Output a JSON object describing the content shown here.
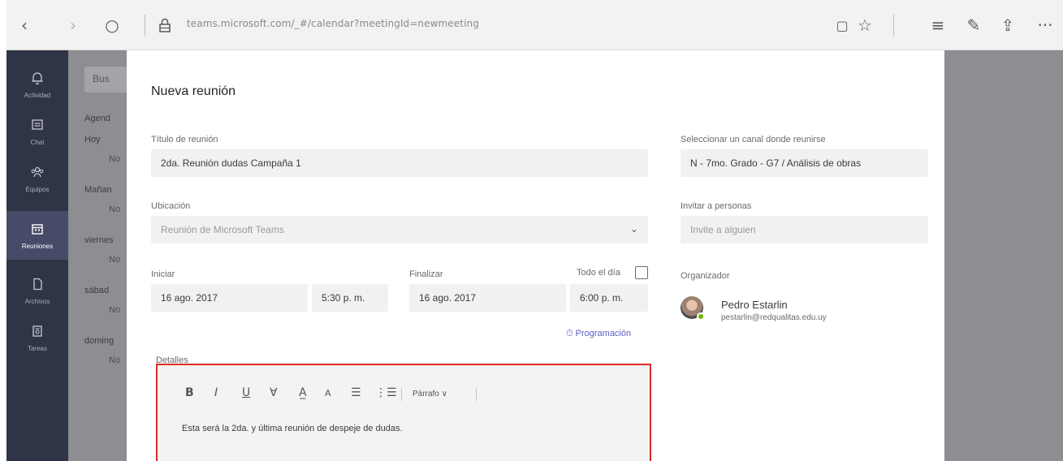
{
  "browser": {
    "url": "teams.microsoft.com/_#/calendar?meetingId=newmeeting",
    "back_icon": "‹",
    "forward_icon": "›",
    "refresh_icon": "○",
    "lock_icon": "🔒",
    "reading_icon": "▢",
    "favorite_icon": "☆",
    "hub_icon": "≡",
    "notes_icon": "✎",
    "share_icon": "⇪",
    "more_icon": "···"
  },
  "rail": {
    "items": [
      {
        "label": "Actividad",
        "icon": "bell-icon",
        "glyph": "🔔"
      },
      {
        "label": "Chat",
        "icon": "chat-icon",
        "glyph": "▤"
      },
      {
        "label": "Equipos",
        "icon": "teams-icon",
        "glyph": "⁂"
      },
      {
        "label": "Reuniones",
        "icon": "calendar-icon",
        "glyph": "▦"
      },
      {
        "label": "Archivos",
        "icon": "files-icon",
        "glyph": "▯"
      },
      {
        "label": "Tareas",
        "icon": "tasks-icon",
        "glyph": "☐"
      }
    ],
    "active_index": 3
  },
  "list_pane": {
    "search_placeholder": "Bus",
    "agenda_label": "Agend",
    "days": [
      {
        "day": "Hoy",
        "note": "No"
      },
      {
        "day": "Mañan",
        "note": "No"
      },
      {
        "day": "viernes",
        "note": "No"
      },
      {
        "day": "sábad",
        "note": "No"
      },
      {
        "day": "doming",
        "note": "No"
      }
    ]
  },
  "form": {
    "title": "Nueva reunión",
    "meeting_title_label": "Título de reunión",
    "meeting_title_value": "2da. Reunión dudas Campaña 1",
    "location_label": "Ubicación",
    "location_value": "Reunión de Microsoft Teams",
    "start_label": "Iniciar",
    "start_date": "16 ago. 2017",
    "start_time": "5:30 p. m.",
    "end_label": "Finalizar",
    "end_date": "16 ago. 2017",
    "end_time": "6:00 p. m.",
    "allday_label": "Todo el día",
    "schedule_link": "⏱ Programación",
    "channel_label": "Seleccionar un canal donde reunirse",
    "channel_value": "N - 7mo. Grado - G7 / Análisis de obras",
    "invite_label": "Invitar a personas",
    "invite_placeholder": "Invite a alguien",
    "organizer_label": "Organizador",
    "organizer_name": "Pedro Estarlin",
    "organizer_email": "pestarlin@redqualitas.edu.uy",
    "details_label": "Detalles",
    "details_text": "Esta será la 2da. y última reunión de despeje de dudas.",
    "format_label": "Párrafo",
    "chevron_icon": "⌄"
  },
  "toolbar_glyphs": {
    "bold": "B",
    "italic": "I",
    "underline": "U",
    "highlight": "∀",
    "font_color": "A̲",
    "font_size": "A",
    "bullets": "☰",
    "numbered": "⋮☰",
    "format_chevron": "∨"
  }
}
